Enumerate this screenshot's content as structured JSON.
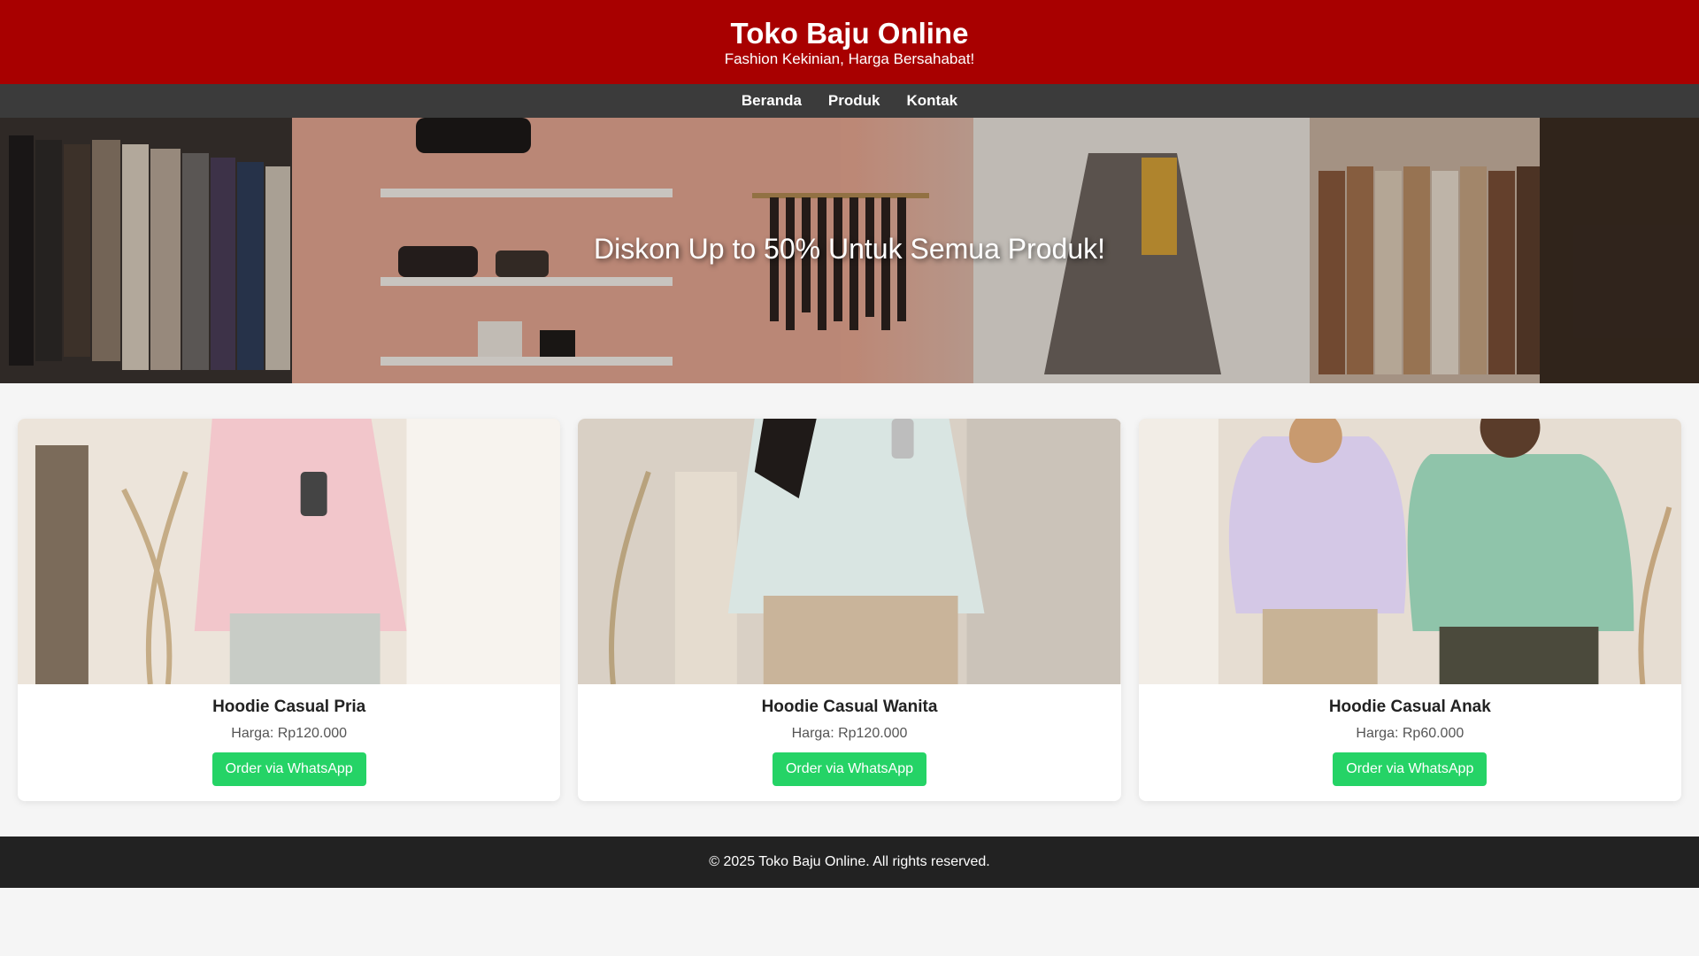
{
  "header": {
    "title": "Toko Baju Online",
    "tagline": "Fashion Kekinian, Harga Bersahabat!"
  },
  "nav": {
    "items": [
      {
        "label": "Beranda"
      },
      {
        "label": "Produk"
      },
      {
        "label": "Kontak"
      }
    ]
  },
  "hero": {
    "text": "Diskon Up to 50% Untuk Semua Produk!"
  },
  "products": [
    {
      "name": "Hoodie Casual Pria",
      "price": "Harga: Rp120.000",
      "button": "Order via WhatsApp"
    },
    {
      "name": "Hoodie Casual Wanita",
      "price": "Harga: Rp120.000",
      "button": "Order via WhatsApp"
    },
    {
      "name": "Hoodie Casual Anak",
      "price": "Harga: Rp60.000",
      "button": "Order via WhatsApp"
    }
  ],
  "footer": {
    "text": "© 2025 Toko Baju Online. All rights reserved."
  },
  "colors": {
    "header_bg": "#a80000",
    "nav_bg": "#3b3b3b",
    "button_bg": "#25d366",
    "footer_bg": "#222222"
  }
}
